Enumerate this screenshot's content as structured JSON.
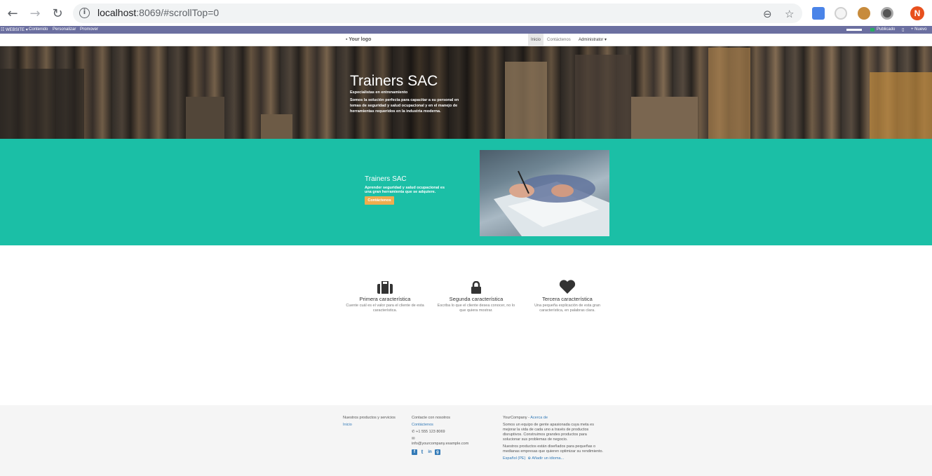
{
  "browser": {
    "url_host": "localhost",
    "url_rest": ":8069/#scrollTop=0",
    "avatar_letter": "N"
  },
  "adminbar": {
    "app": "WEBSITE",
    "menu": [
      "Contenido",
      "Personalizar",
      "Promover"
    ],
    "published": "Publicado",
    "new": "Nuevo"
  },
  "site_nav": {
    "logo": "Your logo",
    "items": [
      "Inicio",
      "Contáctenos"
    ],
    "user": "Administrator"
  },
  "hero": {
    "title": "Trainers SAC",
    "subtitle": "Especialistas en entrenamiento",
    "description": "Somos la solución perfecta para capacitar a su personal en temas de seguridad y salud ocupacional y en el manejo de herramientas requeridos en la industria moderna."
  },
  "teal": {
    "title": "Trainers SAC",
    "description": "Aprender seguridad y salud ocupacional es una gran herramienta que se adquiere.",
    "button": "Contáctenos"
  },
  "features": [
    {
      "icon": "briefcase-icon",
      "title": "Primera característica",
      "desc": "Cuente cuál es el valor para el cliente de esta característica."
    },
    {
      "icon": "lock-icon",
      "title": "Segunda característica",
      "desc": "Escriba lo que el cliente desea conocer, no lo que quiera mostrar."
    },
    {
      "icon": "heart-icon",
      "title": "Tercera característica",
      "desc": "Una pequeña explicación de esta gran característica, en palabras clara."
    }
  ],
  "footer": {
    "col1_title": "Nuestros productos y servicios",
    "col1_link": "Inicio",
    "col2_title": "Contacte con nosotros",
    "col2_link": "Contáctenos",
    "phone": "+1 555 123 8069",
    "email": "info@yourcompany.example.com",
    "col3_company": "YourCompany -",
    "col3_about": "Acerca de",
    "col3_p1": "Somos un equipo de gente apasionada cuya meta es mejorar la vida de cada uno a través de productos disruptivos. Construimos grandes productos para solucionar sus problemas de negocio.",
    "col3_p2": "Nuestros productos están diseñados para pequeñas o medianas empresas que quieren optimizar su rendimiento.",
    "lang": "Español (PE)",
    "add_lang": "Añadir un idioma..."
  },
  "colors": {
    "teal": "#1bbfa6",
    "button": "#f0ad4e",
    "adminbar": "#6b6fa0"
  }
}
